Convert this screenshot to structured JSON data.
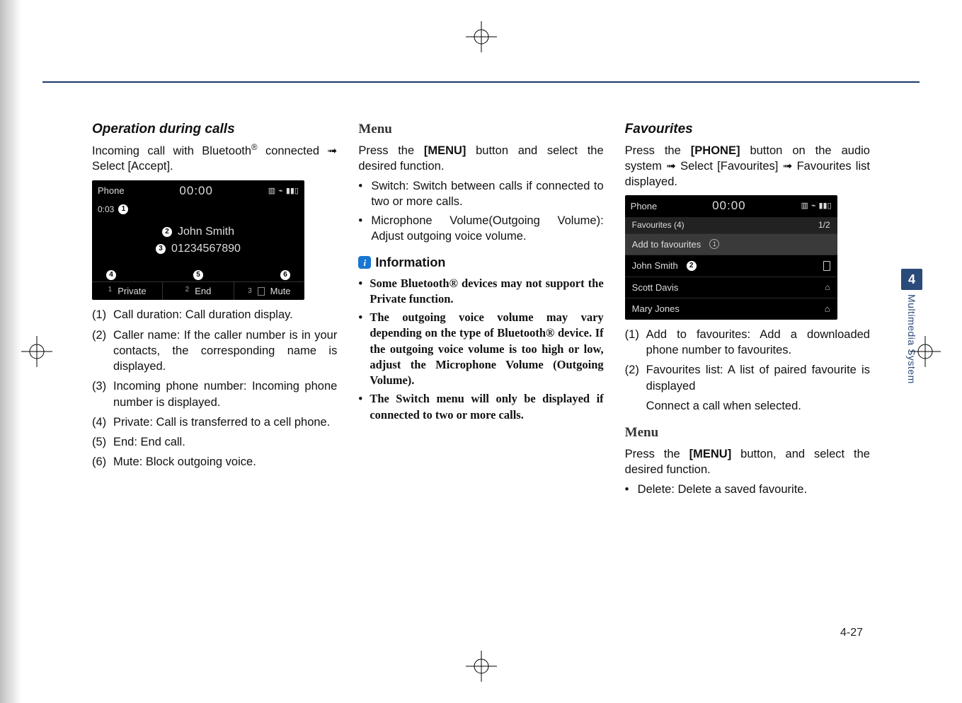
{
  "col1": {
    "heading": "Operation during calls",
    "intro_a": "Incoming call with Bluetooth",
    "intro_reg": "®",
    "intro_b": " connected ➟ Select [Accept].",
    "mock": {
      "title": "Phone",
      "clock": "00:00",
      "duration": "0:03",
      "caller_name": "John Smith",
      "caller_number": "01234567890",
      "btn1": "Private",
      "btn2": "End",
      "btn3": "Mute",
      "n1": "1",
      "n2": "2",
      "n3": "3",
      "c1": "1",
      "c2": "2",
      "c3": "3",
      "c4": "4",
      "c5": "5",
      "c6": "6"
    },
    "list": [
      {
        "n": "(1)",
        "t": "Call duration: Call duration display."
      },
      {
        "n": "(2)",
        "t": "Caller name: If the caller number is in your contacts, the corresponding name is displayed."
      },
      {
        "n": "(3)",
        "t": "Incoming phone number: Incoming phone number is displayed."
      },
      {
        "n": "(4)",
        "t": "Private: Call is transferred to a cell phone."
      },
      {
        "n": "(5)",
        "t": "End: End call."
      },
      {
        "n": "(6)",
        "t": "Mute: Block outgoing voice."
      }
    ]
  },
  "col2": {
    "heading": "Menu",
    "para_a": "Press the ",
    "para_bold": "[MENU]",
    "para_b": " button and select the desired function.",
    "bullets": [
      "Switch: Switch between calls if connected to two or more calls.",
      "Microphone Volume(Outgoing Volume): Adjust outgoing voice volume."
    ],
    "info_label": "Information",
    "info_bullets": [
      "Some Bluetooth® devices may not support the Private function.",
      "The outgoing voice volume may vary depending on the type of Bluetooth® device. If the outgoing voice volume is too high or low, adjust the Microphone Volume (Outgoing Volume).",
      "The Switch menu will only be displayed if connected to two or more calls."
    ]
  },
  "col3": {
    "heading": "Favourites",
    "para_a": "Press the ",
    "para_bold": "[PHONE]",
    "para_b": " button on the audio system ➟ Select [Favourites] ➟ Favourites list displayed.",
    "mock": {
      "title": "Phone",
      "clock": "00:00",
      "subtitle": "Favourites (4)",
      "page": "1/2",
      "item1": "Add to favourites",
      "item2": "John Smith",
      "item3": "Scott Davis",
      "item4": "Mary Jones",
      "c1": "1",
      "c2": "2"
    },
    "list": [
      {
        "n": "(1)",
        "t": "Add to favourites: Add a downloaded phone number to favourites."
      },
      {
        "n": "(2)",
        "t": "Favourites list: A list of paired favourite is displayed"
      },
      {
        "n": "",
        "t": "Connect a call when selected."
      }
    ],
    "menu_heading": "Menu",
    "menu_para_a": "Press the ",
    "menu_para_bold": "[MENU]",
    "menu_para_b": " button, and select the desired function.",
    "menu_bullet": "Delete: Delete a saved favourite."
  },
  "side": {
    "num": "4",
    "text": "Multimedia System"
  },
  "page_number": "4-27"
}
